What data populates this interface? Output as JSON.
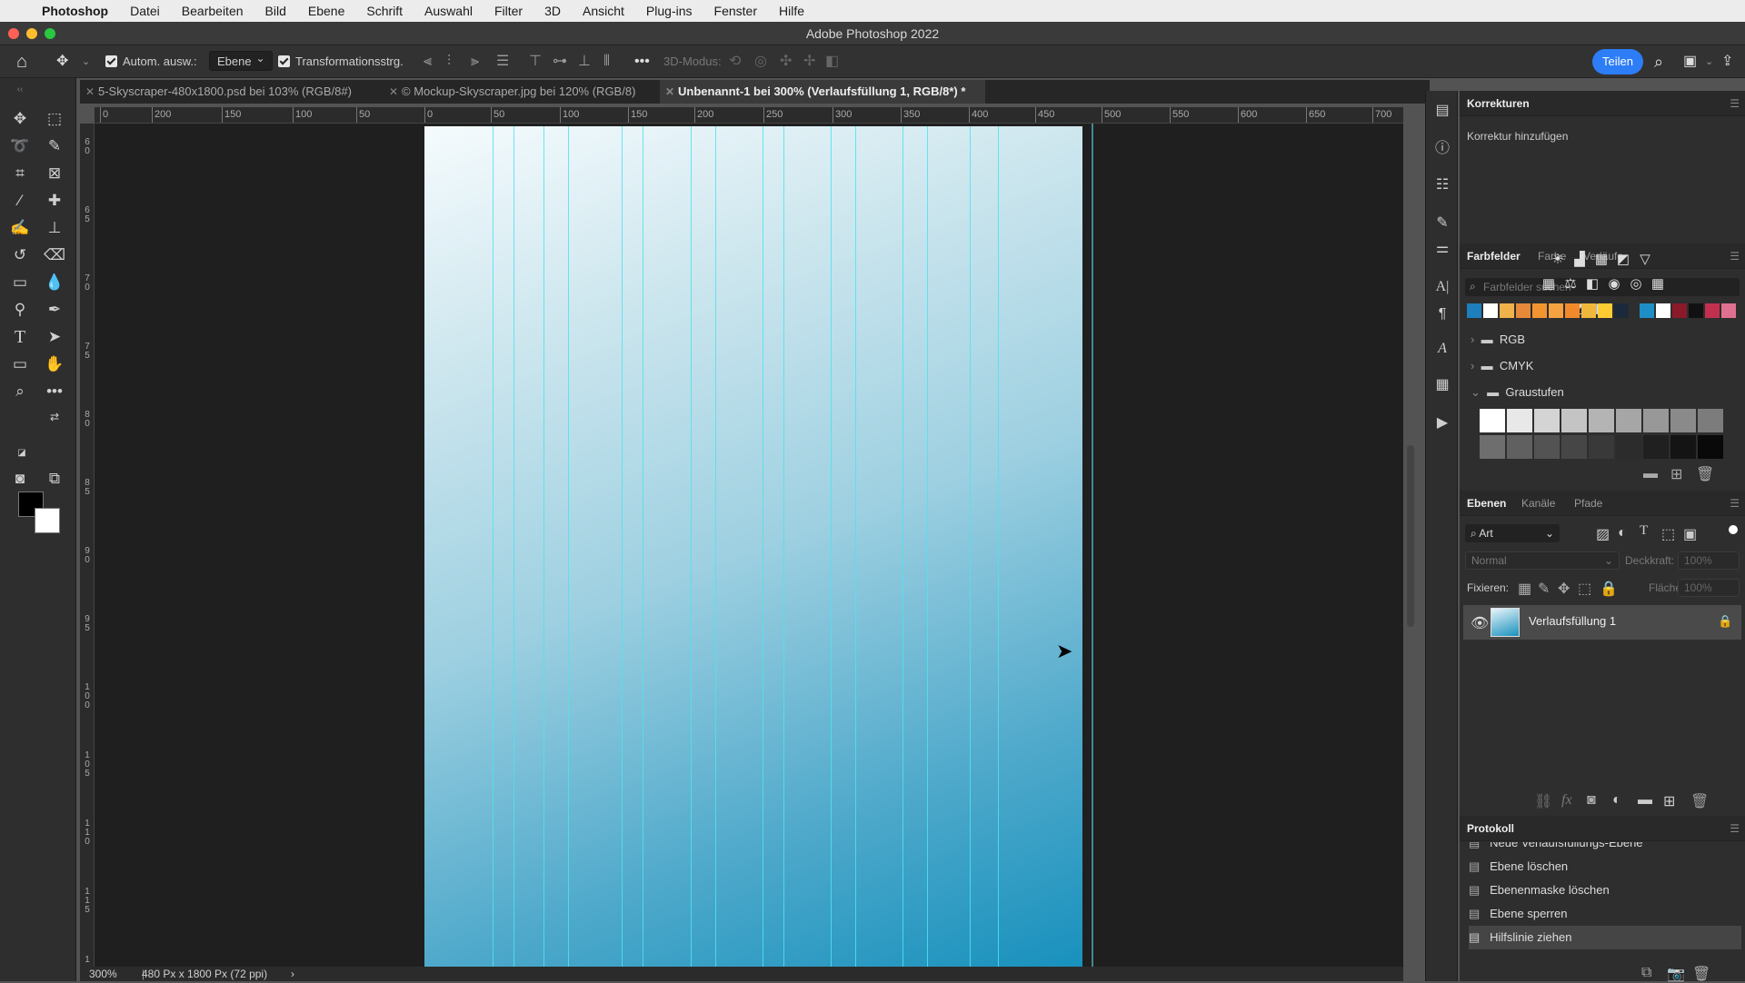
{
  "menubar": {
    "apple": "",
    "app": "Photoshop",
    "items": [
      "Datei",
      "Bearbeiten",
      "Bild",
      "Ebene",
      "Schrift",
      "Auswahl",
      "Filter",
      "3D",
      "Ansicht",
      "Plug-ins",
      "Fenster",
      "Hilfe"
    ]
  },
  "window": {
    "title": "Adobe Photoshop 2022"
  },
  "options": {
    "auto_select": "Autom. ausw.:",
    "auto_select_target": "Ebene",
    "transform_controls": "Transformationsstrg.",
    "mode_3d": "3D-Modus:",
    "share": "Teilen"
  },
  "tabs": [
    {
      "label": "5-Skyscraper-480x1800.psd bei 103% (RGB/8#)"
    },
    {
      "label": "© Mockup-Skyscraper.jpg bei 120% (RGB/8)"
    },
    {
      "label": "Unbenannt-1 bei 300% (Verlaufsfüllung 1, RGB/8*) *"
    }
  ],
  "hruler": [
    "0",
    "200",
    "150",
    "100",
    "50",
    "0",
    "50",
    "100",
    "150",
    "200",
    "250",
    "300",
    "350",
    "400",
    "450",
    "500",
    "550",
    "600",
    "650",
    "700"
  ],
  "vruler": [
    "6 0",
    "6 5",
    "7 0",
    "7 5",
    "8 0",
    "8 5",
    "9 0",
    "9 5",
    "1 0 0",
    "1 0 5",
    "1 1 0",
    "1 1 5",
    "1"
  ],
  "status": {
    "zoom": "300%",
    "doc_info": "480 Px x 1800 Px (72 ppi)",
    "arrow": "›"
  },
  "korrekturen": {
    "title": "Korrekturen",
    "subtitle": "Korrektur hinzufügen"
  },
  "swatches_panel": {
    "tabs": [
      "Farbfelder",
      "Farbe",
      "Verläufe"
    ],
    "search_placeholder": "Farbfelder suchen",
    "recent_colors": [
      "#1d7fbd",
      "#ffffff",
      "#f0b24a",
      "#e8893a",
      "#f29530",
      "#f5a342",
      "#f28a2c",
      "#f0b83a",
      "#ffcc33",
      "#1a2a3a",
      "#1e8fc6",
      "#ffffff",
      "#8a1a2a",
      "#111111",
      "#c23050",
      "#e07090"
    ],
    "groups": [
      "RGB",
      "CMYK",
      "Graustufen"
    ],
    "grays": [
      "#ffffff",
      "#e8e8e8",
      "#d4d4d4",
      "#c4c4c4",
      "#b4b4b4",
      "#a6a6a6",
      "#989898",
      "#8a8a8a",
      "#7c7c7c",
      "#6e6e6e",
      "#606060",
      "#535353",
      "#464646",
      "#393939",
      "#2c2c2c",
      "#202020",
      "#141414",
      "#090909"
    ]
  },
  "layers_panel": {
    "tabs": [
      "Ebenen",
      "Kanäle",
      "Pfade"
    ],
    "filter": "Art",
    "blend_mode": "Normal",
    "opacity_label": "Deckkraft:",
    "opacity_value": "100%",
    "lock_label": "Fixieren:",
    "fill_label": "Fläche:",
    "fill_value": "100%",
    "layers": [
      {
        "name": "Verlaufsfüllung 1"
      }
    ],
    "footer_fx": "fx"
  },
  "history_panel": {
    "title": "Protokoll",
    "items": [
      "Neue Verlaufsfüllungs-Ebene",
      "Ebene löschen",
      "Ebenenmaske löschen",
      "Ebene sperren",
      "Hilfslinie ziehen"
    ]
  }
}
